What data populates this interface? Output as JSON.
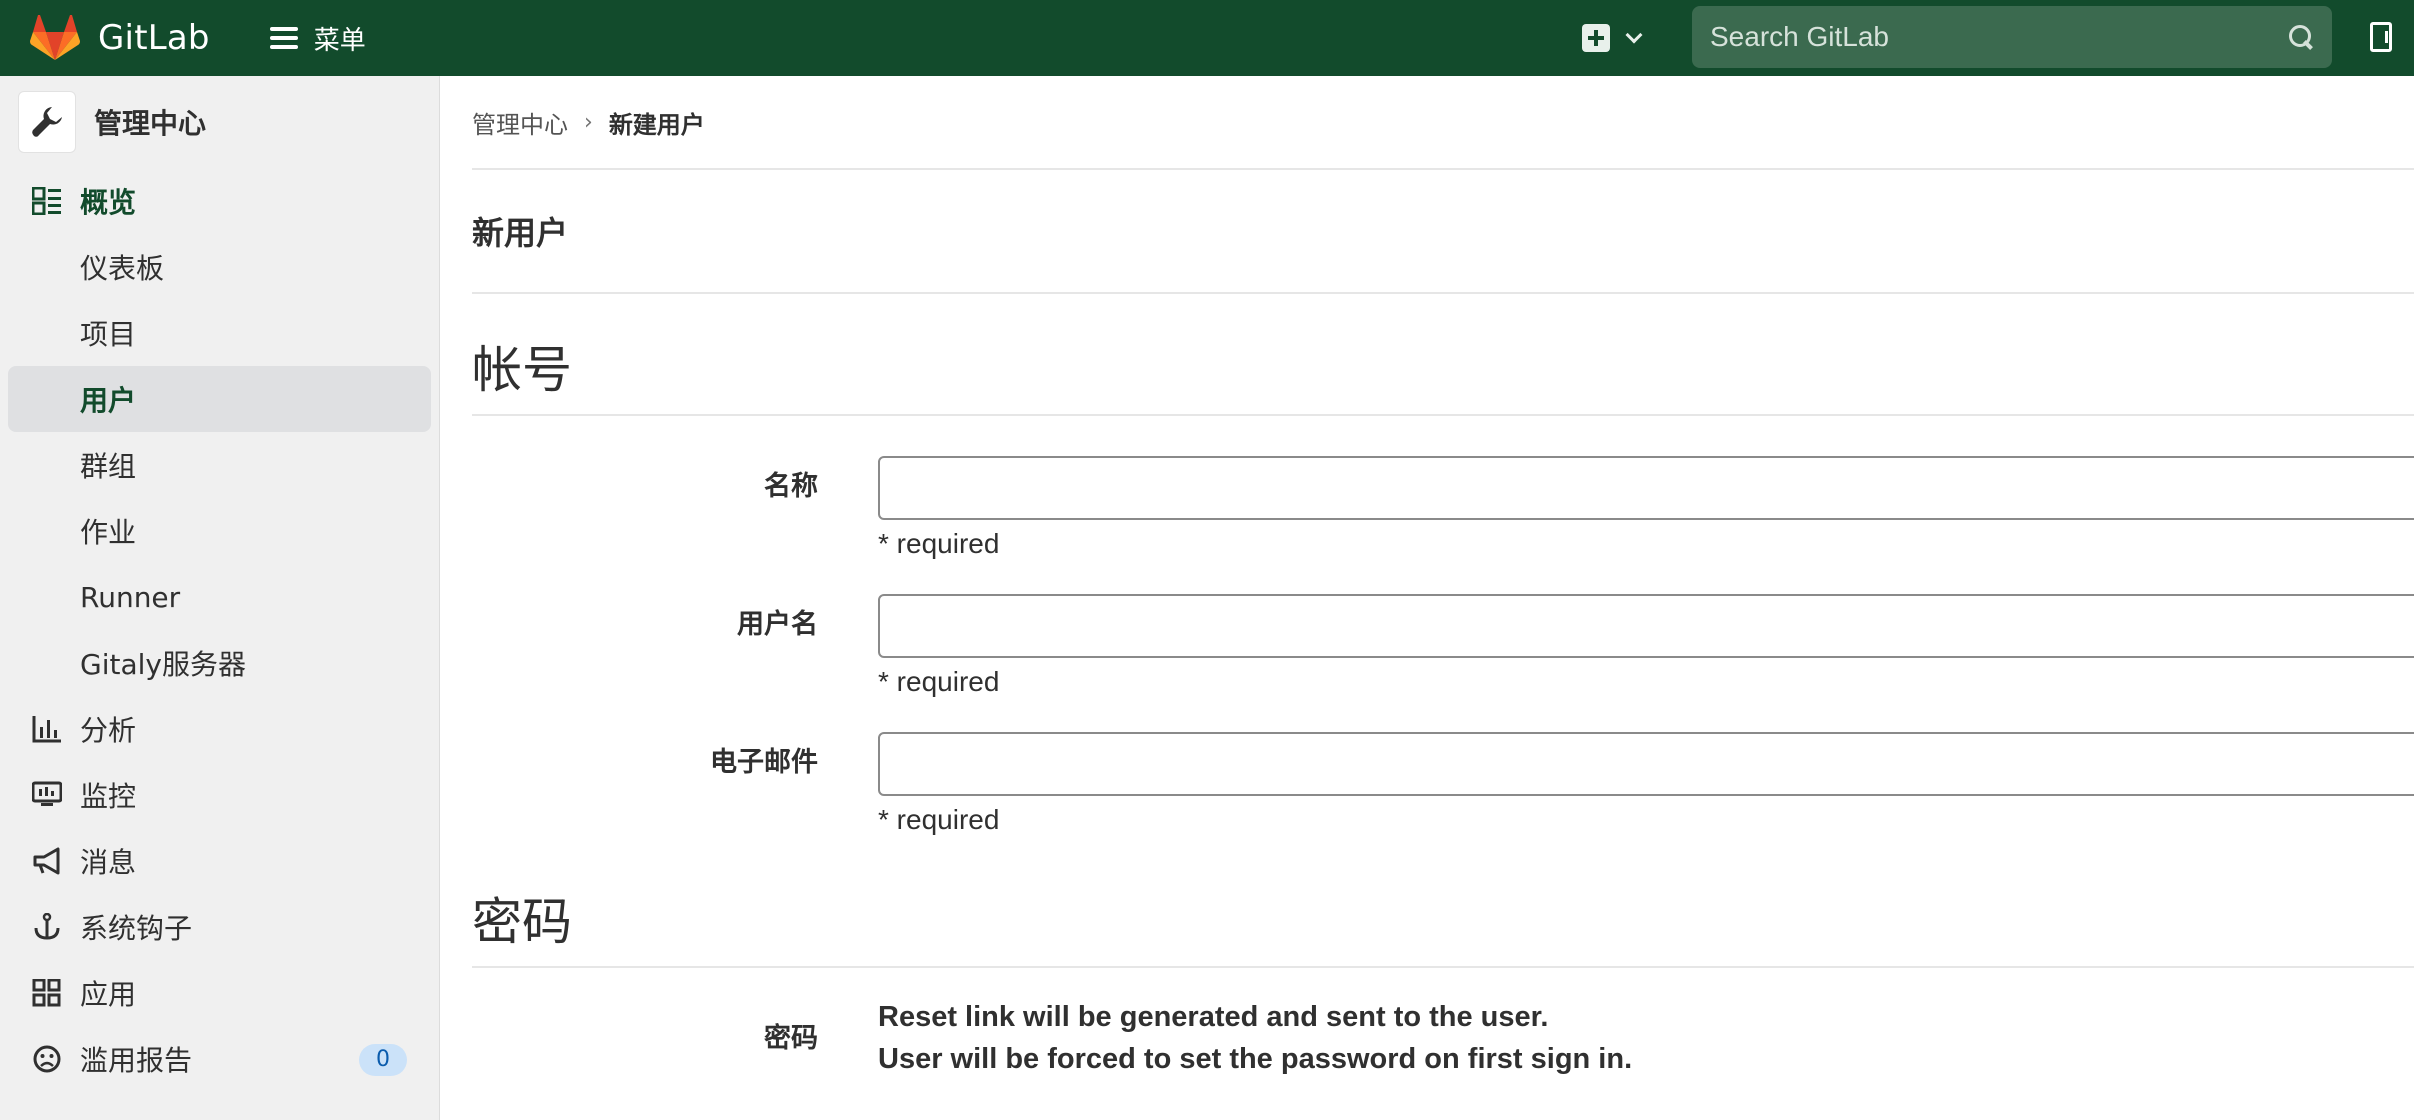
{
  "header": {
    "brand": "GitLab",
    "menu_label": "菜单",
    "search_placeholder": "Search GitLab",
    "accent_color": "#124b2c"
  },
  "sidebar": {
    "title": "管理中心",
    "items": [
      {
        "label": "概览",
        "icon": "overview-icon",
        "level": "top",
        "state": "active-section"
      },
      {
        "label": "仪表板",
        "level": "sub"
      },
      {
        "label": "项目",
        "level": "sub"
      },
      {
        "label": "用户",
        "level": "sub",
        "state": "selected"
      },
      {
        "label": "群组",
        "level": "sub"
      },
      {
        "label": "作业",
        "level": "sub"
      },
      {
        "label": "Runner",
        "level": "sub"
      },
      {
        "label": "Gitaly服务器",
        "level": "sub"
      },
      {
        "label": "分析",
        "icon": "chart-icon",
        "level": "top"
      },
      {
        "label": "监控",
        "icon": "monitor-icon",
        "level": "top"
      },
      {
        "label": "消息",
        "icon": "megaphone-icon",
        "level": "top"
      },
      {
        "label": "系统钩子",
        "icon": "hook-icon",
        "level": "top"
      },
      {
        "label": "应用",
        "icon": "apps-icon",
        "level": "top"
      },
      {
        "label": "滥用报告",
        "icon": "sad-face-icon",
        "level": "top",
        "badge": "0"
      }
    ]
  },
  "breadcrumb": {
    "parent": "管理中心",
    "current": "新建用户"
  },
  "page": {
    "title": "新用户",
    "account_section": "帐号",
    "fields": [
      {
        "label": "名称",
        "value": "",
        "help": "* required"
      },
      {
        "label": "用户名",
        "value": "",
        "help": "* required"
      },
      {
        "label": "电子邮件",
        "value": "",
        "help": "* required"
      }
    ],
    "password_section": "密码",
    "password_label": "密码",
    "password_note_1": "Reset link will be generated and sent to the user.",
    "password_note_2": "User will be forced to set the password on first sign in."
  }
}
